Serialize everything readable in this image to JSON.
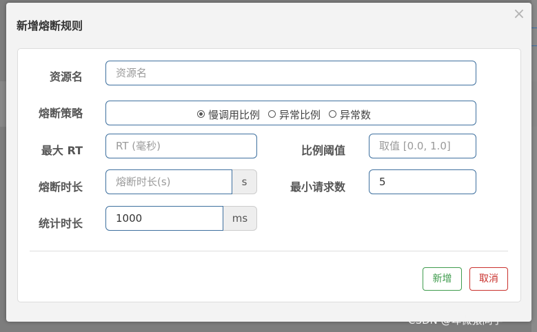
{
  "dialog": {
    "title": "新增熔断规则",
    "close_symbol": "×"
  },
  "form": {
    "resource": {
      "label": "资源名",
      "placeholder": "资源名",
      "value": ""
    },
    "strategy": {
      "label": "熔断策略",
      "options": [
        {
          "label": "慢调用比例",
          "checked": true
        },
        {
          "label": "异常比例",
          "checked": false
        },
        {
          "label": "异常数",
          "checked": false
        }
      ]
    },
    "max_rt": {
      "label": "最大 RT",
      "placeholder": "RT (毫秒)",
      "value": ""
    },
    "ratio_threshold": {
      "label": "比例阈值",
      "placeholder": "取值 [0.0, 1.0]",
      "value": ""
    },
    "break_duration": {
      "label": "熔断时长",
      "placeholder": "熔断时长(s)",
      "value": "",
      "unit": "s"
    },
    "min_requests": {
      "label": "最小请求数",
      "placeholder": "",
      "value": "5"
    },
    "stat_duration": {
      "label": "统计时长",
      "placeholder": "",
      "value": "1000",
      "unit": "ms"
    }
  },
  "buttons": {
    "add": "新增",
    "cancel": "取消"
  },
  "watermark": "CSDN @卑微猿同学",
  "colors": {
    "input_border": "#3d6f9e",
    "add_button": "#3e9b4c",
    "cancel_button": "#c9302c"
  }
}
